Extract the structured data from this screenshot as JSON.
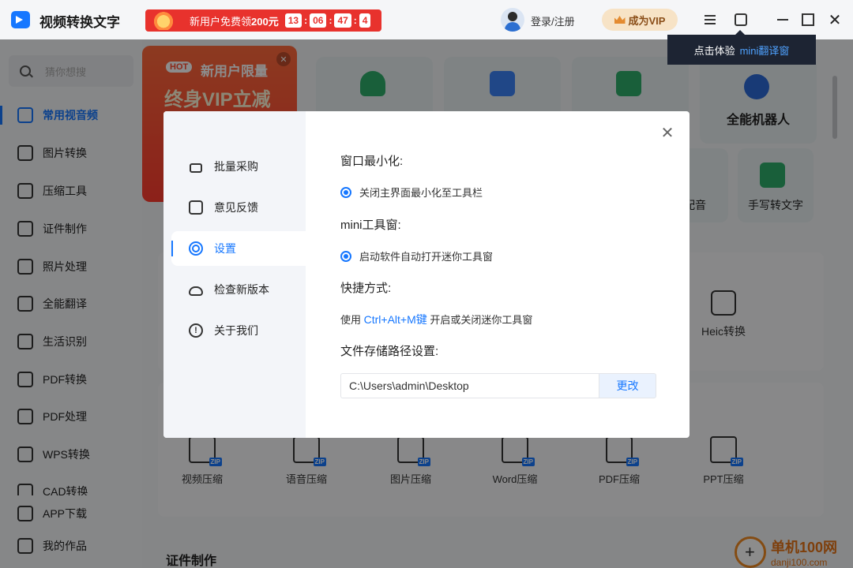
{
  "app": {
    "title": "视频转换文字"
  },
  "promo": {
    "text_prefix": "新用户免费领",
    "amount": "200元",
    "timer": [
      "13",
      "06",
      "47",
      "4"
    ]
  },
  "account": {
    "login_label": "登录/注册",
    "vip_label": "成为VIP"
  },
  "tooltip": {
    "prefix": "点击体验",
    "highlight": "mini翻译窗"
  },
  "search": {
    "placeholder": "猜你想搜"
  },
  "sidebar": {
    "items": [
      {
        "label": "常用视音频",
        "icon": "video-icon",
        "active": true
      },
      {
        "label": "图片转换",
        "icon": "image-icon"
      },
      {
        "label": "压缩工具",
        "icon": "compress-icon"
      },
      {
        "label": "证件制作",
        "icon": "id-card-icon"
      },
      {
        "label": "照片处理",
        "icon": "photo-icon"
      },
      {
        "label": "全能翻译",
        "icon": "translate-icon"
      },
      {
        "label": "生活识别",
        "icon": "cup-icon"
      },
      {
        "label": "PDF转换",
        "icon": "pdf-convert-icon"
      },
      {
        "label": "PDF处理",
        "icon": "pdf-process-icon"
      },
      {
        "label": "WPS转换",
        "icon": "wps-icon"
      },
      {
        "label": "CAD转换",
        "icon": "cad-icon"
      }
    ],
    "bottom": [
      {
        "label": "APP下载",
        "icon": "phone-icon"
      },
      {
        "label": "我的作品",
        "icon": "bag-icon"
      }
    ]
  },
  "hot_banner": {
    "tag": "HOT",
    "line1": "新用户限量",
    "line2": "终身VIP立减"
  },
  "features": {
    "robot": "全能机器人",
    "dubbing": "配音",
    "handwriting": "手写转文字",
    "heic": "Heic转换"
  },
  "compress": {
    "items": [
      "视频压缩",
      "语音压缩",
      "图片压缩",
      "Word压缩",
      "PDF压缩",
      "PPT压缩"
    ]
  },
  "sections": {
    "id_making": "证件制作"
  },
  "modal": {
    "menu": [
      {
        "label": "批量采购",
        "icon": "purchase-icon"
      },
      {
        "label": "意见反馈",
        "icon": "feedback-icon"
      },
      {
        "label": "设置",
        "icon": "settings-icon",
        "active": true
      },
      {
        "label": "检查新版本",
        "icon": "update-icon"
      },
      {
        "label": "关于我们",
        "icon": "info-icon"
      }
    ],
    "settings": {
      "window_min_label": "窗口最小化:",
      "window_min_option": "关闭主界面最小化至工具栏",
      "mini_label": "mini工具窗:",
      "mini_option": "启动软件自动打开迷你工具窗",
      "shortcut_label": "快捷方式:",
      "shortcut_prefix": "使用",
      "shortcut_key": "Ctrl+Alt+M键",
      "shortcut_suffix": "开启或关闭迷你工具窗",
      "path_label": "文件存储路径设置:",
      "path_value": "C:\\Users\\admin\\Desktop",
      "change_label": "更改"
    }
  },
  "watermark": {
    "line1": "单机100网",
    "line2": "danji100.com"
  },
  "colors": {
    "accent": "#1677ff",
    "promo": "#e8322d",
    "vip_bg": "#f7e3c6"
  }
}
